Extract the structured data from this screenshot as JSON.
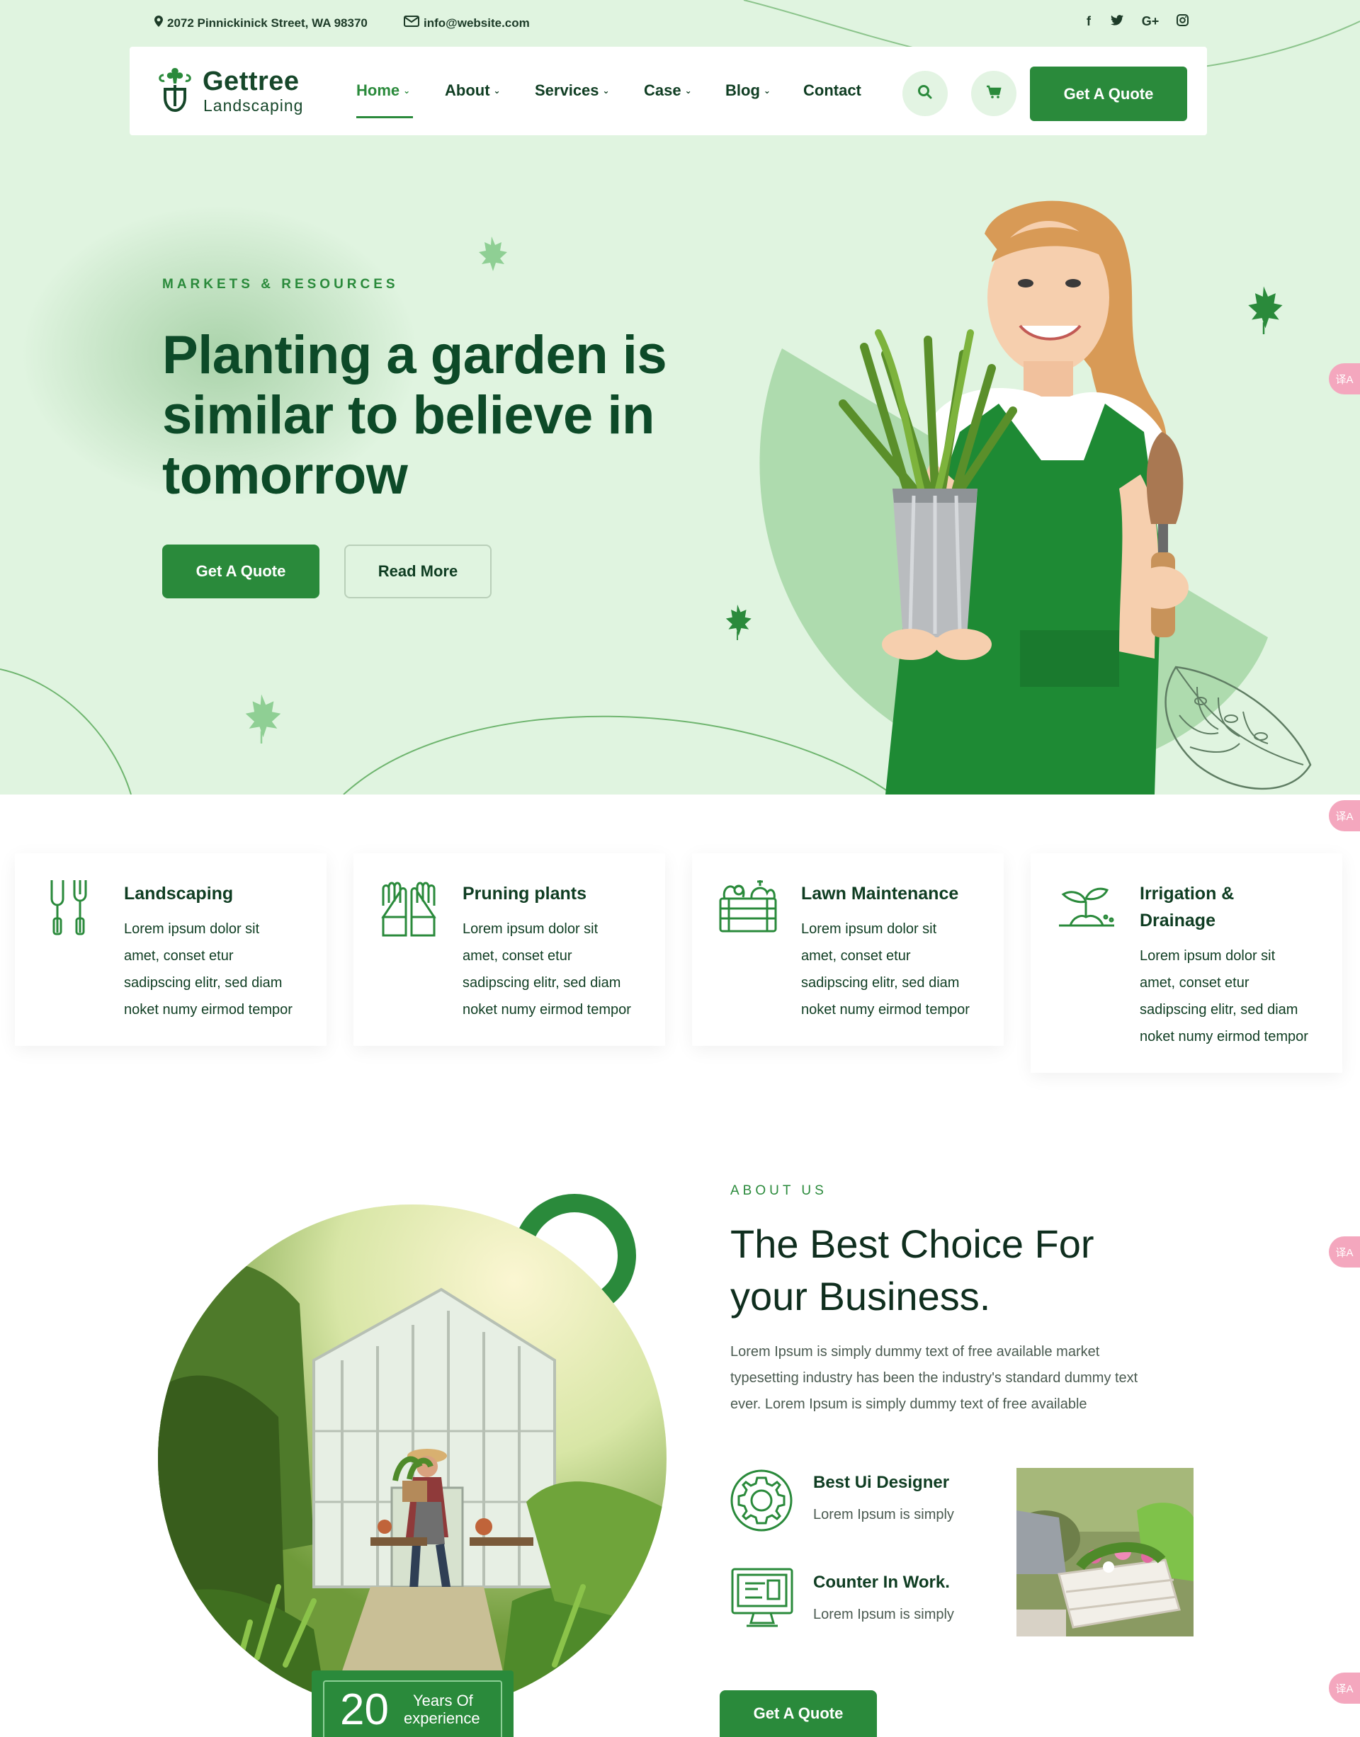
{
  "topbar": {
    "address": "2072 Pinnickinick Street, WA 98370",
    "email": "info@website.com",
    "social": [
      "f",
      "t",
      "G+",
      "ig"
    ]
  },
  "brand": {
    "name": "Gettree",
    "tagline": "Landscaping"
  },
  "nav": {
    "items": [
      {
        "label": "Home",
        "dropdown": true,
        "active": true
      },
      {
        "label": "About",
        "dropdown": true
      },
      {
        "label": "Services",
        "dropdown": true
      },
      {
        "label": "Case",
        "dropdown": true
      },
      {
        "label": "Blog",
        "dropdown": true
      },
      {
        "label": "Contact",
        "dropdown": false
      }
    ],
    "cta": "Get A Quote"
  },
  "hero": {
    "eyebrow": "MARKETS & RESOURCES",
    "title_lines": [
      "Planting a garden is",
      "similar to believe in",
      "tomorrow"
    ],
    "primary_button": "Get A Quote",
    "secondary_button": "Read More"
  },
  "services": [
    {
      "title": "Landscaping",
      "text": [
        "Lorem ipsum dolor sit",
        "amet, conset etur",
        "sadipscing elitr, sed diam",
        "noket numy eirmod tempor"
      ],
      "icon": "garden-tools-icon"
    },
    {
      "title": "Pruning plants",
      "text": [
        "Lorem ipsum dolor sit",
        "amet, conset etur",
        "sadipscing elitr, sed diam",
        "noket numy eirmod tempor"
      ],
      "icon": "gloves-icon"
    },
    {
      "title": "Lawn Maintenance",
      "text": [
        "Lorem ipsum dolor sit",
        "amet, conset etur",
        "sadipscing elitr, sed diam",
        "noket numy eirmod tempor"
      ],
      "icon": "vegetable-crate-icon"
    },
    {
      "title_lines": [
        "Irrigation &",
        "Drainage"
      ],
      "text": [
        "Lorem ipsum dolor sit",
        "amet, conset etur",
        "sadipscing elitr, sed diam",
        "noket numy eirmod tempor"
      ],
      "icon": "sprout-icon"
    }
  ],
  "about": {
    "eyebrow": "ABOUT US",
    "title_lines": [
      "The Best Choice For",
      "your Business."
    ],
    "text_lines": [
      "Lorem Ipsum is simply dummy text of free available market",
      "typesetting industry has been the industry's standard dummy text",
      "ever. Lorem Ipsum is simply dummy text of free available"
    ],
    "features": [
      {
        "title": "Best Ui Designer",
        "text": "Lorem Ipsum is simply",
        "icon": "gear-icon"
      },
      {
        "title": "Counter In Work.",
        "text": "Lorem Ipsum is simply",
        "icon": "monitor-icon"
      }
    ],
    "experience": {
      "number": "20",
      "label_lines": [
        "Years Of",
        "experience"
      ]
    },
    "button": "Get A Quote"
  },
  "translate_badge": "译A",
  "colors": {
    "primary": "#2a8a3b",
    "hero_bg": "#e0f4e0",
    "heading": "#0d4a28"
  }
}
